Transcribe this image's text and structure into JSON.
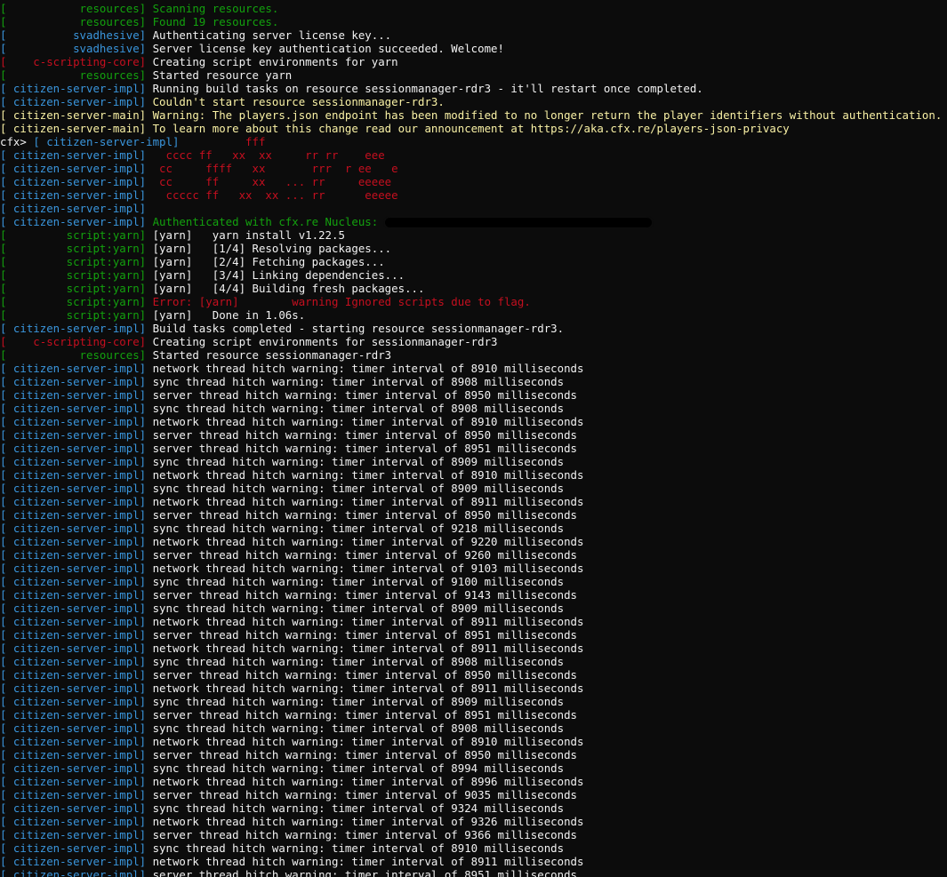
{
  "colors": {
    "green": "#13a10e",
    "blue": "#3a96dd",
    "red": "#c50f1f",
    "yellow": "#f9f1a5",
    "white": "#f2f2f2",
    "background": "#0c0c0c"
  },
  "prompt": "cfx>",
  "lines": [
    {
      "tag": "           resources",
      "bcolor": "green",
      "tcolor": "green",
      "msg": "Scanning resources.",
      "mcolor": "green"
    },
    {
      "tag": "           resources",
      "bcolor": "green",
      "tcolor": "green",
      "msg": "Found 19 resources.",
      "mcolor": "green"
    },
    {
      "tag": "          svadhesive",
      "bcolor": "teal",
      "tcolor": "teal",
      "msg": "Authenticating server license key...",
      "mcolor": "white"
    },
    {
      "tag": "          svadhesive",
      "bcolor": "teal",
      "tcolor": "teal",
      "msg": "Server license key authentication succeeded. Welcome!",
      "mcolor": "white"
    },
    {
      "tag": "    c-scripting-core",
      "bcolor": "red",
      "tcolor": "red",
      "msg": "Creating script environments for yarn",
      "mcolor": "white"
    },
    {
      "tag": "           resources",
      "bcolor": "green",
      "tcolor": "green",
      "msg": "Started resource yarn",
      "mcolor": "white"
    },
    {
      "tag": " citizen-server-impl",
      "bcolor": "teal",
      "tcolor": "teal",
      "msg": "Running build tasks on resource sessionmanager-rdr3 - it'll restart once completed.",
      "mcolor": "white"
    },
    {
      "tag": " citizen-server-impl",
      "bcolor": "teal",
      "tcolor": "teal",
      "msg": "Couldn't start resource sessionmanager-rdr3.",
      "mcolor": "yellow"
    },
    {
      "tag": " citizen-server-main",
      "bcolor": "yellow",
      "tcolor": "yellow",
      "msg": "Warning: The players.json endpoint has been modified to no longer return the player identifiers without authentication.",
      "mcolor": "yellow"
    },
    {
      "tag": " citizen-server-main",
      "bcolor": "yellow",
      "tcolor": "yellow",
      "msg": "To learn more about this change read our announcement at https://aka.cfx.re/players-json-privacy",
      "mcolor": "yellow"
    },
    {
      "prompt": true,
      "tag": " citizen-server-impl",
      "bcolor": "teal",
      "tcolor": "teal",
      "msg": "         fff",
      "mcolor": "red"
    },
    {
      "tag": " citizen-server-impl",
      "bcolor": "teal",
      "tcolor": "teal",
      "msg": "  cccc ff   xx  xx     rr rr    eee",
      "mcolor": "red"
    },
    {
      "tag": " citizen-server-impl",
      "bcolor": "teal",
      "tcolor": "teal",
      "msg": " cc     ffff   xx       rrr  r ee   e",
      "mcolor": "red"
    },
    {
      "tag": " citizen-server-impl",
      "bcolor": "teal",
      "tcolor": "teal",
      "msg": " cc     ff     xx   ... rr     eeeee",
      "mcolor": "red"
    },
    {
      "tag": " citizen-server-impl",
      "bcolor": "teal",
      "tcolor": "teal",
      "msg": "  ccccc ff   xx  xx ... rr      eeeee",
      "mcolor": "red"
    },
    {
      "tag": " citizen-server-impl",
      "bcolor": "teal",
      "tcolor": "teal",
      "msg": "",
      "mcolor": "white"
    },
    {
      "tag": " citizen-server-impl",
      "bcolor": "teal",
      "tcolor": "teal",
      "msg": "Authenticated with cfx.re Nucleus: ",
      "mcolor": "green",
      "redacted": true
    },
    {
      "tag": "         script:yarn",
      "bcolor": "green",
      "tcolor": "green",
      "msg": "[yarn]   yarn install v1.22.5",
      "mcolor": "white"
    },
    {
      "tag": "         script:yarn",
      "bcolor": "green",
      "tcolor": "green",
      "msg": "[yarn]   [1/4] Resolving packages...",
      "mcolor": "white"
    },
    {
      "tag": "         script:yarn",
      "bcolor": "green",
      "tcolor": "green",
      "msg": "[yarn]   [2/4] Fetching packages...",
      "mcolor": "white"
    },
    {
      "tag": "         script:yarn",
      "bcolor": "green",
      "tcolor": "green",
      "msg": "[yarn]   [3/4] Linking dependencies...",
      "mcolor": "white"
    },
    {
      "tag": "         script:yarn",
      "bcolor": "green",
      "tcolor": "green",
      "msg": "[yarn]   [4/4] Building fresh packages...",
      "mcolor": "white"
    },
    {
      "tag": "         script:yarn",
      "bcolor": "green",
      "tcolor": "green",
      "msg": "Error: [yarn]        warning Ignored scripts due to flag.",
      "mcolor": "red"
    },
    {
      "tag": "         script:yarn",
      "bcolor": "green",
      "tcolor": "green",
      "msg": "[yarn]   Done in 1.06s.",
      "mcolor": "white"
    },
    {
      "tag": " citizen-server-impl",
      "bcolor": "teal",
      "tcolor": "teal",
      "msg": "Build tasks completed - starting resource sessionmanager-rdr3.",
      "mcolor": "white"
    },
    {
      "tag": "    c-scripting-core",
      "bcolor": "red",
      "tcolor": "red",
      "msg": "Creating script environments for sessionmanager-rdr3",
      "mcolor": "white"
    },
    {
      "tag": "           resources",
      "bcolor": "green",
      "tcolor": "green",
      "msg": "Started resource sessionmanager-rdr3",
      "mcolor": "white"
    },
    {
      "tag": " citizen-server-impl",
      "bcolor": "teal",
      "tcolor": "teal",
      "msg": "network thread hitch warning: timer interval of 8910 milliseconds",
      "mcolor": "white"
    },
    {
      "tag": " citizen-server-impl",
      "bcolor": "teal",
      "tcolor": "teal",
      "msg": "sync thread hitch warning: timer interval of 8908 milliseconds",
      "mcolor": "white"
    },
    {
      "tag": " citizen-server-impl",
      "bcolor": "teal",
      "tcolor": "teal",
      "msg": "server thread hitch warning: timer interval of 8950 milliseconds",
      "mcolor": "white"
    },
    {
      "tag": " citizen-server-impl",
      "bcolor": "teal",
      "tcolor": "teal",
      "msg": "sync thread hitch warning: timer interval of 8908 milliseconds",
      "mcolor": "white"
    },
    {
      "tag": " citizen-server-impl",
      "bcolor": "teal",
      "tcolor": "teal",
      "msg": "network thread hitch warning: timer interval of 8910 milliseconds",
      "mcolor": "white"
    },
    {
      "tag": " citizen-server-impl",
      "bcolor": "teal",
      "tcolor": "teal",
      "msg": "server thread hitch warning: timer interval of 8950 milliseconds",
      "mcolor": "white"
    },
    {
      "tag": " citizen-server-impl",
      "bcolor": "teal",
      "tcolor": "teal",
      "msg": "server thread hitch warning: timer interval of 8951 milliseconds",
      "mcolor": "white"
    },
    {
      "tag": " citizen-server-impl",
      "bcolor": "teal",
      "tcolor": "teal",
      "msg": "sync thread hitch warning: timer interval of 8909 milliseconds",
      "mcolor": "white"
    },
    {
      "tag": " citizen-server-impl",
      "bcolor": "teal",
      "tcolor": "teal",
      "msg": "network thread hitch warning: timer interval of 8910 milliseconds",
      "mcolor": "white"
    },
    {
      "tag": " citizen-server-impl",
      "bcolor": "teal",
      "tcolor": "teal",
      "msg": "sync thread hitch warning: timer interval of 8909 milliseconds",
      "mcolor": "white"
    },
    {
      "tag": " citizen-server-impl",
      "bcolor": "teal",
      "tcolor": "teal",
      "msg": "network thread hitch warning: timer interval of 8911 milliseconds",
      "mcolor": "white"
    },
    {
      "tag": " citizen-server-impl",
      "bcolor": "teal",
      "tcolor": "teal",
      "msg": "server thread hitch warning: timer interval of 8950 milliseconds",
      "mcolor": "white"
    },
    {
      "tag": " citizen-server-impl",
      "bcolor": "teal",
      "tcolor": "teal",
      "msg": "sync thread hitch warning: timer interval of 9218 milliseconds",
      "mcolor": "white"
    },
    {
      "tag": " citizen-server-impl",
      "bcolor": "teal",
      "tcolor": "teal",
      "msg": "network thread hitch warning: timer interval of 9220 milliseconds",
      "mcolor": "white"
    },
    {
      "tag": " citizen-server-impl",
      "bcolor": "teal",
      "tcolor": "teal",
      "msg": "server thread hitch warning: timer interval of 9260 milliseconds",
      "mcolor": "white"
    },
    {
      "tag": " citizen-server-impl",
      "bcolor": "teal",
      "tcolor": "teal",
      "msg": "network thread hitch warning: timer interval of 9103 milliseconds",
      "mcolor": "white"
    },
    {
      "tag": " citizen-server-impl",
      "bcolor": "teal",
      "tcolor": "teal",
      "msg": "sync thread hitch warning: timer interval of 9100 milliseconds",
      "mcolor": "white"
    },
    {
      "tag": " citizen-server-impl",
      "bcolor": "teal",
      "tcolor": "teal",
      "msg": "server thread hitch warning: timer interval of 9143 milliseconds",
      "mcolor": "white"
    },
    {
      "tag": " citizen-server-impl",
      "bcolor": "teal",
      "tcolor": "teal",
      "msg": "sync thread hitch warning: timer interval of 8909 milliseconds",
      "mcolor": "white"
    },
    {
      "tag": " citizen-server-impl",
      "bcolor": "teal",
      "tcolor": "teal",
      "msg": "network thread hitch warning: timer interval of 8911 milliseconds",
      "mcolor": "white"
    },
    {
      "tag": " citizen-server-impl",
      "bcolor": "teal",
      "tcolor": "teal",
      "msg": "server thread hitch warning: timer interval of 8951 milliseconds",
      "mcolor": "white"
    },
    {
      "tag": " citizen-server-impl",
      "bcolor": "teal",
      "tcolor": "teal",
      "msg": "network thread hitch warning: timer interval of 8911 milliseconds",
      "mcolor": "white"
    },
    {
      "tag": " citizen-server-impl",
      "bcolor": "teal",
      "tcolor": "teal",
      "msg": "sync thread hitch warning: timer interval of 8908 milliseconds",
      "mcolor": "white"
    },
    {
      "tag": " citizen-server-impl",
      "bcolor": "teal",
      "tcolor": "teal",
      "msg": "server thread hitch warning: timer interval of 8950 milliseconds",
      "mcolor": "white"
    },
    {
      "tag": " citizen-server-impl",
      "bcolor": "teal",
      "tcolor": "teal",
      "msg": "network thread hitch warning: timer interval of 8911 milliseconds",
      "mcolor": "white"
    },
    {
      "tag": " citizen-server-impl",
      "bcolor": "teal",
      "tcolor": "teal",
      "msg": "sync thread hitch warning: timer interval of 8909 milliseconds",
      "mcolor": "white"
    },
    {
      "tag": " citizen-server-impl",
      "bcolor": "teal",
      "tcolor": "teal",
      "msg": "server thread hitch warning: timer interval of 8951 milliseconds",
      "mcolor": "white"
    },
    {
      "tag": " citizen-server-impl",
      "bcolor": "teal",
      "tcolor": "teal",
      "msg": "sync thread hitch warning: timer interval of 8908 milliseconds",
      "mcolor": "white"
    },
    {
      "tag": " citizen-server-impl",
      "bcolor": "teal",
      "tcolor": "teal",
      "msg": "network thread hitch warning: timer interval of 8910 milliseconds",
      "mcolor": "white"
    },
    {
      "tag": " citizen-server-impl",
      "bcolor": "teal",
      "tcolor": "teal",
      "msg": "server thread hitch warning: timer interval of 8950 milliseconds",
      "mcolor": "white"
    },
    {
      "tag": " citizen-server-impl",
      "bcolor": "teal",
      "tcolor": "teal",
      "msg": "sync thread hitch warning: timer interval of 8994 milliseconds",
      "mcolor": "white"
    },
    {
      "tag": " citizen-server-impl",
      "bcolor": "teal",
      "tcolor": "teal",
      "msg": "network thread hitch warning: timer interval of 8996 milliseconds",
      "mcolor": "white"
    },
    {
      "tag": " citizen-server-impl",
      "bcolor": "teal",
      "tcolor": "teal",
      "msg": "server thread hitch warning: timer interval of 9035 milliseconds",
      "mcolor": "white"
    },
    {
      "tag": " citizen-server-impl",
      "bcolor": "teal",
      "tcolor": "teal",
      "msg": "sync thread hitch warning: timer interval of 9324 milliseconds",
      "mcolor": "white"
    },
    {
      "tag": " citizen-server-impl",
      "bcolor": "teal",
      "tcolor": "teal",
      "msg": "network thread hitch warning: timer interval of 9326 milliseconds",
      "mcolor": "white"
    },
    {
      "tag": " citizen-server-impl",
      "bcolor": "teal",
      "tcolor": "teal",
      "msg": "server thread hitch warning: timer interval of 9366 milliseconds",
      "mcolor": "white"
    },
    {
      "tag": " citizen-server-impl",
      "bcolor": "teal",
      "tcolor": "teal",
      "msg": "sync thread hitch warning: timer interval of 8910 milliseconds",
      "mcolor": "white"
    },
    {
      "tag": " citizen-server-impl",
      "bcolor": "teal",
      "tcolor": "teal",
      "msg": "network thread hitch warning: timer interval of 8911 milliseconds",
      "mcolor": "white"
    },
    {
      "tag": " citizen-server-impl",
      "bcolor": "teal",
      "tcolor": "teal",
      "msg": "server thread hitch warning: timer interval of 8951 milliseconds",
      "mcolor": "white"
    }
  ]
}
